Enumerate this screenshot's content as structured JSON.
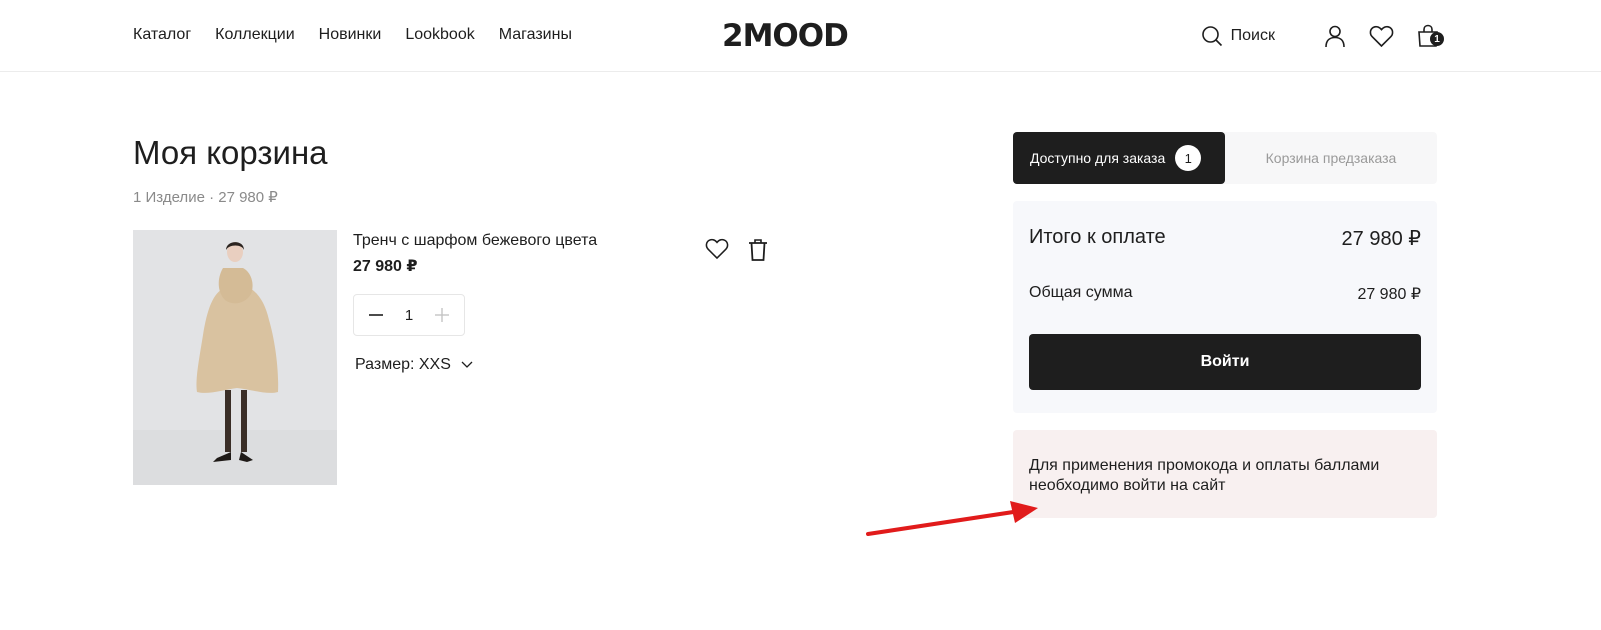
{
  "header": {
    "nav": [
      "Каталог",
      "Коллекции",
      "Новинки",
      "Lookbook",
      "Магазины"
    ],
    "logo": "2MOOD",
    "search_label": "Поиск",
    "cart_count": "1",
    "icons": [
      "search-icon",
      "user-icon",
      "heart-icon",
      "bag-icon"
    ]
  },
  "cart": {
    "title": "Моя корзина",
    "summary": "1 Изделие · 27 980 ₽"
  },
  "item": {
    "name": "Тренч с шарфом бежевого цвета",
    "price": "27 980 ₽",
    "quantity": "1",
    "size_label": "Размер: XXS"
  },
  "tabs": {
    "available": "Доступно для заказа",
    "available_count": "1",
    "preorder": "Корзина предзаказа"
  },
  "totals": {
    "total_label": "Итого к оплате",
    "total_value": "27 980 ₽",
    "sum_label": "Общая сумма",
    "sum_value": "27 980 ₽",
    "login_button": "Войти"
  },
  "promo": {
    "text": "Для применения промокода и оплаты баллами необходимо войти на сайт"
  },
  "colors": {
    "primary": "#1e1e1e",
    "promo_bg": "#f8f0f0",
    "arrow": "#e11b1b"
  }
}
